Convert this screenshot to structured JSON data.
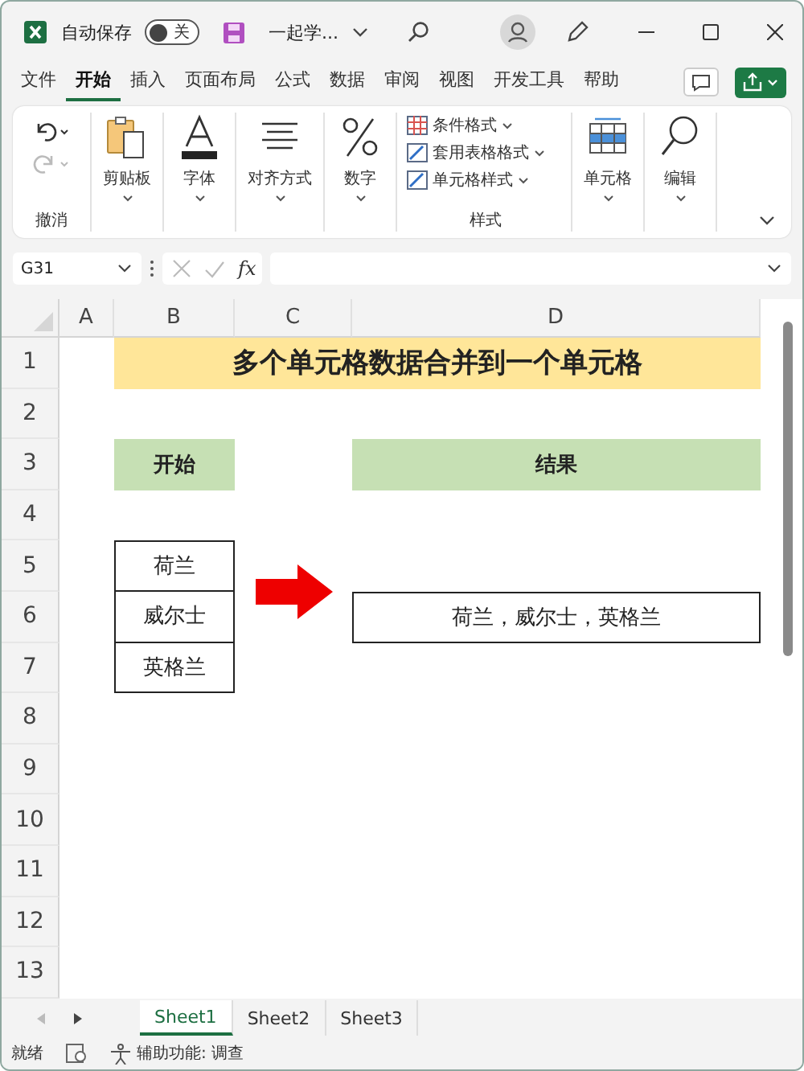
{
  "title_bar": {
    "autosave_label": "自动保存",
    "autosave_toggle": {
      "on": false,
      "label": "关"
    },
    "document_title": "一起学..."
  },
  "menu_tabs": [
    {
      "label": "文件",
      "selected": false
    },
    {
      "label": "开始",
      "selected": true
    },
    {
      "label": "插入",
      "selected": false
    },
    {
      "label": "页面布局",
      "selected": false
    },
    {
      "label": "公式",
      "selected": false
    },
    {
      "label": "数据",
      "selected": false
    },
    {
      "label": "审阅",
      "selected": false
    },
    {
      "label": "视图",
      "selected": false
    },
    {
      "label": "开发工具",
      "selected": false
    },
    {
      "label": "帮助",
      "selected": false
    }
  ],
  "ribbon_groups": [
    {
      "kind": "undo",
      "label": "撤消"
    },
    {
      "kind": "clipboard",
      "label": "剪贴板"
    },
    {
      "kind": "font",
      "label": "字体"
    },
    {
      "kind": "alignment",
      "label": "对齐方式"
    },
    {
      "kind": "number",
      "label": "数字"
    },
    {
      "kind": "styles",
      "label": "样式",
      "items": [
        "条件格式",
        "套用表格格式",
        "单元格样式"
      ]
    },
    {
      "kind": "cells",
      "label": "单元格"
    },
    {
      "kind": "editing",
      "label": "编辑"
    }
  ],
  "formula_bar": {
    "name_box": "G31",
    "function_label": "fx"
  },
  "sheet": {
    "columns": [
      "A",
      "B",
      "C",
      "D"
    ],
    "rows": [
      "1",
      "2",
      "3",
      "4",
      "5",
      "6",
      "7",
      "8",
      "9",
      "10",
      "11",
      "12",
      "13"
    ],
    "title": "多个单元格数据合并到一个单元格",
    "start_header": "开始",
    "result_header": "结果",
    "start_values": [
      "荷兰",
      "威尔士",
      "英格兰"
    ],
    "result_value": "荷兰，威尔士，英格兰"
  },
  "sheet_tabs": [
    {
      "label": "Sheet1",
      "selected": true
    },
    {
      "label": "Sheet2",
      "selected": false
    },
    {
      "label": "Sheet3",
      "selected": false
    }
  ],
  "status_bar": {
    "ready": "就绪",
    "accessibility": "辅助功能: 调查"
  }
}
